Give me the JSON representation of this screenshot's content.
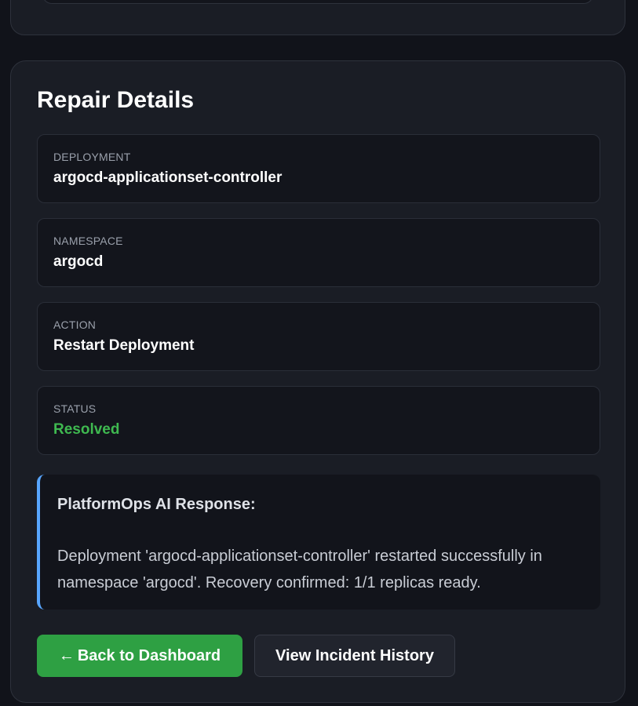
{
  "repair": {
    "title": "Repair Details",
    "fields": [
      {
        "label": "DEPLOYMENT",
        "value": "argocd-applicationset-controller"
      },
      {
        "label": "NAMESPACE",
        "value": "argocd"
      },
      {
        "label": "ACTION",
        "value": "Restart Deployment"
      },
      {
        "label": "STATUS",
        "value": "Resolved"
      }
    ],
    "status_color": "#3fb950"
  },
  "ai_response": {
    "title": "PlatformOps AI Response:",
    "text": "Deployment 'argocd-applicationset-controller' restarted successfully in namespace 'argocd'. Recovery confirmed: 1/1 replicas ready.",
    "accent_color": "#58a6ff"
  },
  "actions": {
    "back_icon": "←",
    "back_label": "Back to Dashboard",
    "history_label": "View Incident History",
    "back_color": "#2ea043"
  }
}
